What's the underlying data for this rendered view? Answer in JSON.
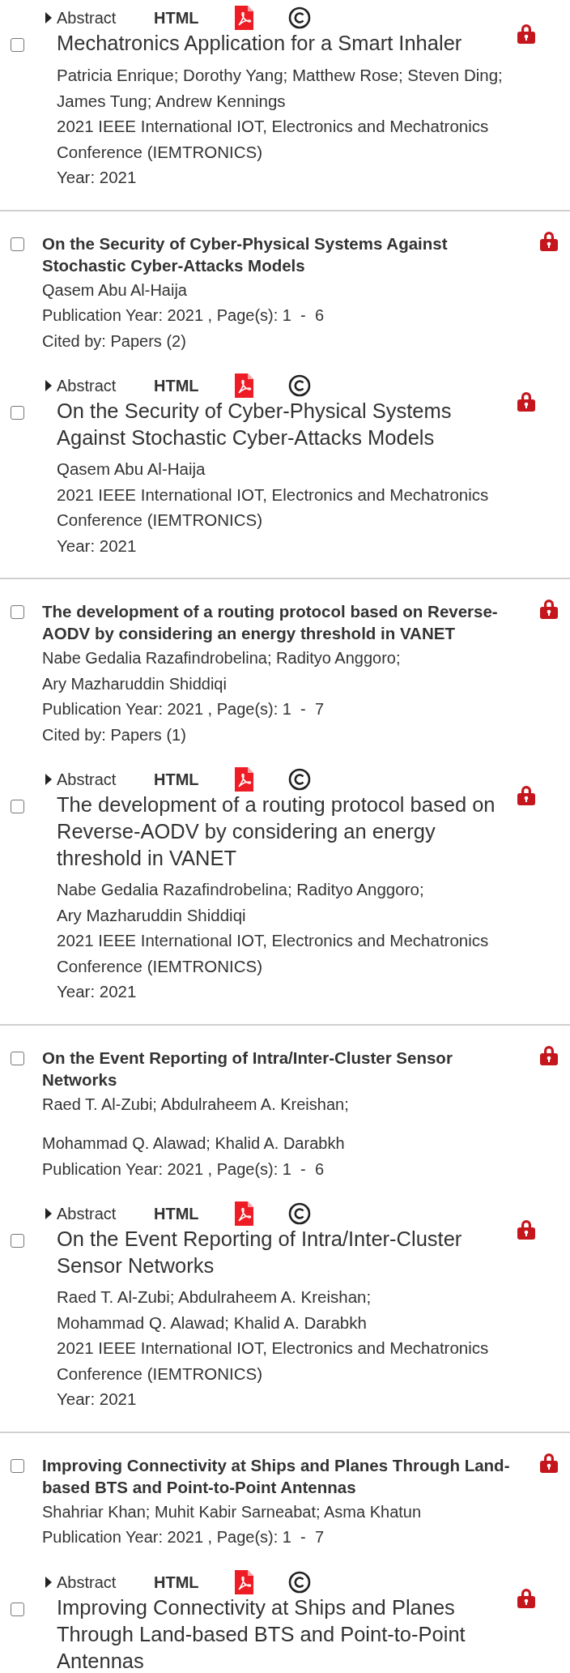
{
  "entries": [
    {
      "kind": "detail",
      "selected": false,
      "abstract": "Abstract",
      "html": "HTML",
      "title": "Mechatronics Application for a Smart Inhaler",
      "authors": [
        "Patricia Enrique; Dorothy Yang; Matthew Rose; Steven Ding;",
        "James Tung; Andrew Kennings"
      ],
      "venue": "2021 IEEE International IOT, Electronics and Mechatronics Conference (IEMTRONICS)",
      "year": "Year: 2021",
      "separator": true
    },
    {
      "kind": "summary",
      "selected": false,
      "title": "On the Security of Cyber-Physical Systems Against Stochastic Cyber-Attacks Models",
      "author_groups": [
        [
          "Qasem Abu Al-Haija"
        ]
      ],
      "publication": "Publication Year: 2021 , Page(s): 1  -  6",
      "cited": "Cited by: Papers (2)"
    },
    {
      "kind": "detail",
      "selected": false,
      "abstract": "Abstract",
      "html": "HTML",
      "title": "On the Security of Cyber-Physical Systems Against Stochastic Cyber-Attacks Models",
      "authors": [
        "Qasem Abu Al-Haija"
      ],
      "venue": "2021 IEEE International IOT, Electronics and Mechatronics Conference (IEMTRONICS)",
      "year": "Year: 2021",
      "separator": true
    },
    {
      "kind": "summary",
      "selected": false,
      "title": "The development of a routing protocol based on Reverse-AODV by considering an energy threshold in VANET",
      "author_groups": [
        [
          "Nabe Gedalia Razafindrobelina; Radityo Anggoro;",
          "Ary Mazharuddin Shiddiqi"
        ]
      ],
      "publication": "Publication Year: 2021 , Page(s): 1  -  7",
      "cited": "Cited by: Papers (1)"
    },
    {
      "kind": "detail",
      "selected": false,
      "abstract": "Abstract",
      "html": "HTML",
      "title": "The development of a routing protocol based on Reverse-AODV by considering an energy threshold in VANET",
      "authors": [
        "Nabe Gedalia Razafindrobelina; Radityo Anggoro;",
        "Ary Mazharuddin Shiddiqi"
      ],
      "venue": "2021 IEEE International IOT, Electronics and Mechatronics Conference (IEMTRONICS)",
      "year": "Year: 2021",
      "separator": true
    },
    {
      "kind": "summary",
      "selected": false,
      "title": "On the Event Reporting of Intra/Inter-Cluster Sensor Networks",
      "author_groups": [
        [
          "Raed T. Al-Zubi; Abdulraheem A. Kreishan;"
        ],
        [
          "Mohammad Q. Alawad; Khalid A. Darabkh"
        ]
      ],
      "publication": "Publication Year: 2021 , Page(s): 1  -  6"
    },
    {
      "kind": "detail",
      "selected": false,
      "abstract": "Abstract",
      "html": "HTML",
      "title": "On the Event Reporting of Intra/Inter-Cluster Sensor Networks",
      "authors": [
        "Raed T. Al-Zubi; Abdulraheem A. Kreishan;",
        "Mohammad Q. Alawad; Khalid A. Darabkh"
      ],
      "venue": "2021 IEEE International IOT, Electronics and Mechatronics Conference (IEMTRONICS)",
      "year": "Year: 2021",
      "separator": true
    },
    {
      "kind": "summary",
      "selected": false,
      "title": "Improving Connectivity at Ships and Planes Through Land-based BTS and Point-to-Point Antennas",
      "author_groups": [
        [
          "Shahriar Khan; Muhit Kabir Sarneabat; Asma Khatun"
        ]
      ],
      "publication": "Publication Year: 2021 , Page(s): 1  -  7"
    },
    {
      "kind": "detail",
      "selected": false,
      "abstract": "Abstract",
      "html": "HTML",
      "title": "Improving Connectivity at Ships and Planes Through Land-based BTS and Point-to-Point Antennas"
    }
  ]
}
